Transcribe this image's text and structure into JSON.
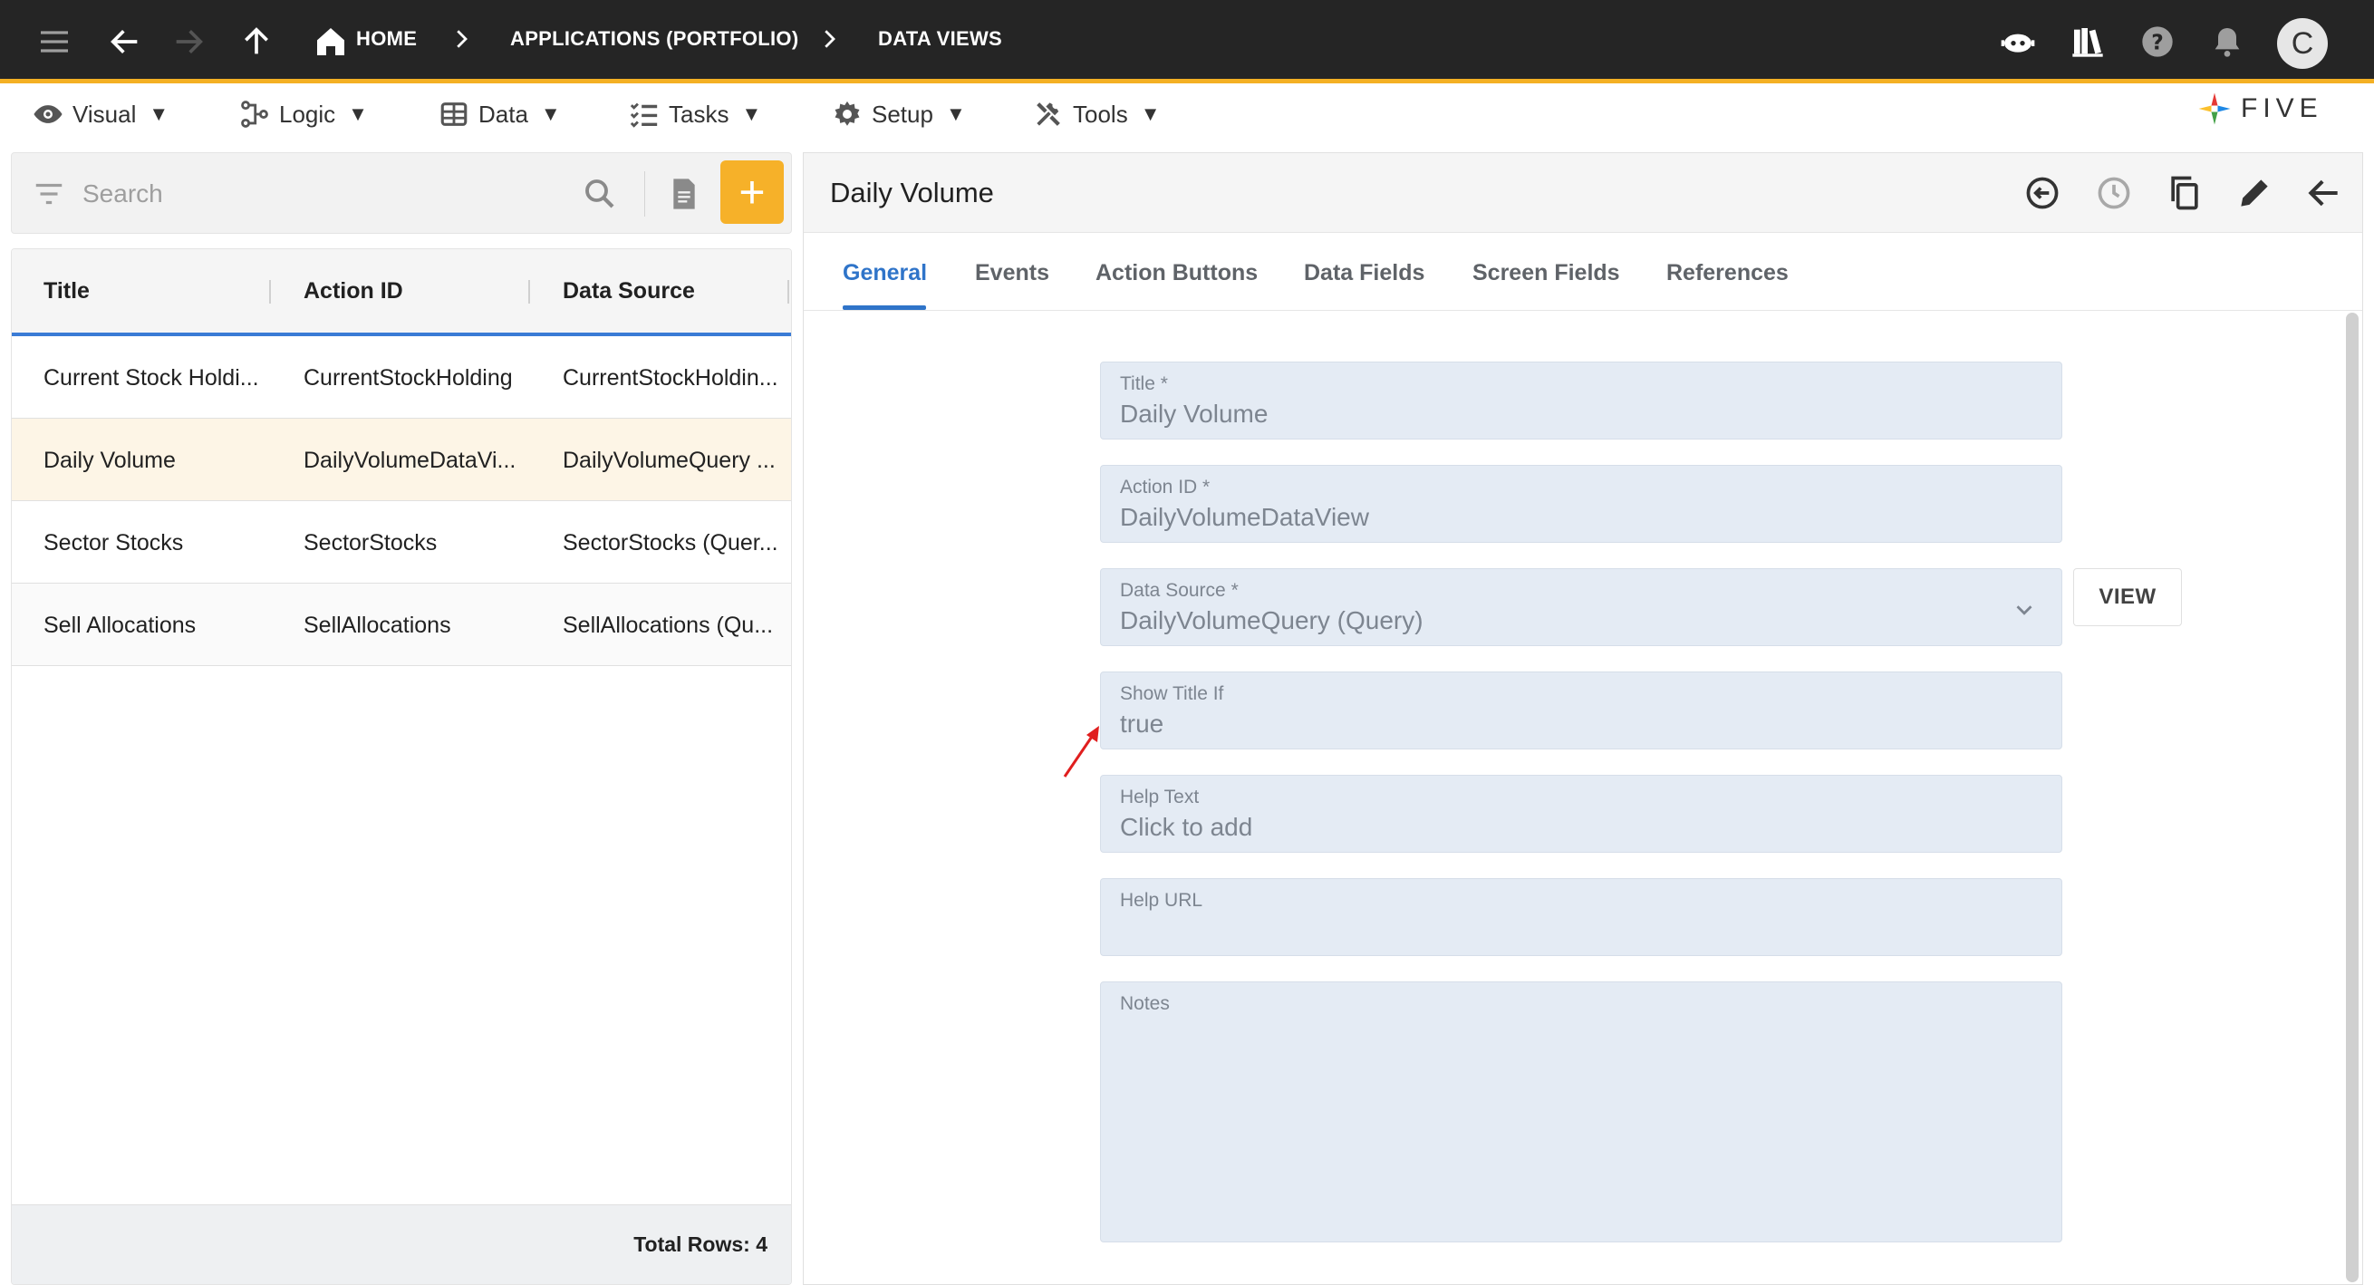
{
  "topbar": {
    "breadcrumbs": [
      "HOME",
      "APPLICATIONS (PORTFOLIO)",
      "DATA VIEWS"
    ],
    "avatar_letter": "C",
    "icons": [
      "menu-icon",
      "back-arrow-icon",
      "forward-arrow-icon",
      "up-arrow-icon",
      "home-icon",
      "chatbot-icon",
      "library-icon",
      "help-icon",
      "bell-icon"
    ],
    "accent_color": "#f4b024",
    "background_color": "#252525"
  },
  "menubar": {
    "items": [
      {
        "label": "Visual",
        "icon": "eye-icon"
      },
      {
        "label": "Logic",
        "icon": "flow-icon"
      },
      {
        "label": "Data",
        "icon": "table-icon"
      },
      {
        "label": "Tasks",
        "icon": "checklist-icon"
      },
      {
        "label": "Setup",
        "icon": "gear-icon"
      },
      {
        "label": "Tools",
        "icon": "tools-icon"
      }
    ],
    "caret": "▼",
    "logo_text": "FIVE"
  },
  "list": {
    "search_placeholder": "Search",
    "add_label": "+",
    "columns": [
      "Title",
      "Action ID",
      "Data Source"
    ],
    "rows": [
      {
        "title": "Current Stock Holdi...",
        "action_id": "CurrentStockHolding",
        "data_source": "CurrentStockHoldin...",
        "selected": false
      },
      {
        "title": "Daily Volume",
        "action_id": "DailyVolumeDataVi...",
        "data_source": "DailyVolumeQuery ...",
        "selected": true
      },
      {
        "title": "Sector Stocks",
        "action_id": "SectorStocks",
        "data_source": "SectorStocks (Quer...",
        "selected": false
      },
      {
        "title": "Sell Allocations",
        "action_id": "SellAllocations",
        "data_source": "SellAllocations (Qu...",
        "selected": false
      }
    ],
    "total_rows": "Total Rows: 4",
    "selected_color": "#fdf5e6",
    "header_underline_color": "#3a7bd5"
  },
  "detail": {
    "title": "Daily Volume",
    "actions": [
      "history-back-icon",
      "clock-icon",
      "copy-icon",
      "edit-icon",
      "back-arrow-icon"
    ],
    "tabs": [
      "General",
      "Events",
      "Action Buttons",
      "Data Fields",
      "Screen Fields",
      "References"
    ],
    "active_tab": "General",
    "active_color": "#2f74c9",
    "fields": [
      {
        "label": "Title *",
        "value": "Daily Volume"
      },
      {
        "label": "Action ID *",
        "value": "DailyVolumeDataView"
      },
      {
        "label": "Data Source *",
        "value": "DailyVolumeQuery (Query)"
      },
      {
        "label": "Show Title If",
        "value": "true"
      },
      {
        "label": "Help Text",
        "value": "Click to add"
      },
      {
        "label": "Help URL",
        "value": ""
      },
      {
        "label": "Notes",
        "value": ""
      }
    ],
    "view_button": "VIEW",
    "field_background": "#e4ebf4"
  }
}
